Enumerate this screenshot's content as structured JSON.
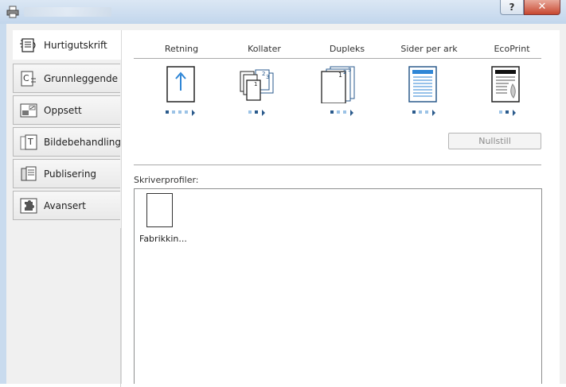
{
  "window": {
    "help_label": "?",
    "close_label": "✕"
  },
  "sidebar": {
    "items": [
      {
        "label": "Hurtigutskrift",
        "icon": "quick-print-icon",
        "active": true
      },
      {
        "label": "Grunnleggende",
        "icon": "basic-settings-icon"
      },
      {
        "label": "Oppsett",
        "icon": "layout-icon"
      },
      {
        "label": "Bildebehandling",
        "icon": "imaging-icon"
      },
      {
        "label": "Publisering",
        "icon": "publishing-icon"
      },
      {
        "label": "Avansert",
        "icon": "advanced-puzzle-icon"
      }
    ]
  },
  "quick_print": {
    "columns": [
      {
        "label": "Retning",
        "icon": "orientation-portrait-icon"
      },
      {
        "label": "Kollater",
        "icon": "collate-icon"
      },
      {
        "label": "Dupleks",
        "icon": "duplex-icon"
      },
      {
        "label": "Sider per ark",
        "icon": "pages-per-sheet-icon"
      },
      {
        "label": "EcoPrint",
        "icon": "ecoprint-icon"
      }
    ],
    "collate_numbers": [
      "1",
      "2",
      "3"
    ],
    "duplex_numbers": [
      "1",
      "2",
      "3"
    ],
    "reset_label": "Nullstill"
  },
  "profiles": {
    "label": "Skriverprofiler:",
    "items": [
      {
        "name": "Fabrikkin..."
      }
    ]
  },
  "colors": {
    "accent": "#2a5a8c",
    "accent_light": "#9cc3e6",
    "titlebar": "#c9dbee",
    "close_button": "#c7472f"
  }
}
